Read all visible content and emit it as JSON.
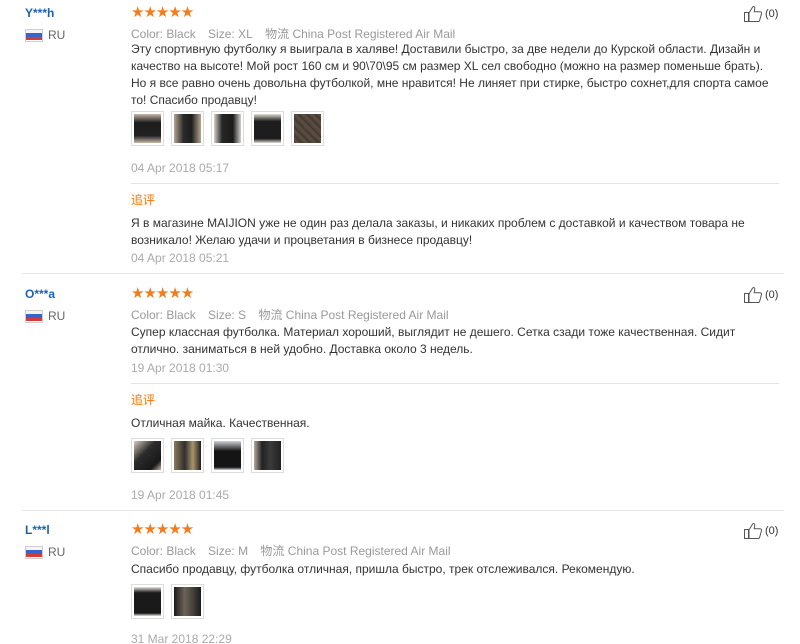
{
  "reviews": [
    {
      "user": "Y***h",
      "country": "RU",
      "stars": "★★★★★",
      "color_label": "Color:",
      "color_value": "Black",
      "size_label": "Size:",
      "size_value": "XL",
      "shipping_label": "物流",
      "shipping_value": "China Post Registered Air Mail",
      "text": "Эту спортивную футболку я выиграла в халяве! Доставили быстро, за две недели до Курской области. Дизайн и качество на высоте! Мой рост 160 см и 90\\70\\95 см размер XL сел свободно (можно на размер поменьше брать). Но я все равно очень довольна футболкой, мне нравится! Не линяет при стирке, быстро сохнет,для спорта самое то! Спасибо продавцу!",
      "photos": [
        "photo-1",
        "photo-2",
        "photo-3",
        "photo-4",
        "photo-5"
      ],
      "date": "04 Apr 2018 05:17",
      "followup_label": "追评",
      "followup_text": "Я в магазине MAIJION уже не один раз делала заказы, и никаких проблем с доставкой и качеством товара не возникало! Желаю удачи и процветания в бизнесе продавцу!",
      "followup_date": "04 Apr 2018 05:21",
      "likes": "(0)"
    },
    {
      "user": "O***a",
      "country": "RU",
      "stars": "★★★★★",
      "color_label": "Color:",
      "color_value": "Black",
      "size_label": "Size:",
      "size_value": "S",
      "shipping_label": "物流",
      "shipping_value": "China Post Registered Air Mail",
      "text": "Супер классная футболка. Материал хороший, выглядит не дешего. Сетка сзади тоже качественная. Сидит отлично. заниматься в ней удобно. Доставка около 3 недель.",
      "date": "19 Apr 2018 01:30",
      "followup_label": "追评",
      "followup_text": "Отличная майка. Качественная.",
      "followup_photos": [
        "photo-1",
        "photo-2",
        "photo-3",
        "photo-4"
      ],
      "followup_date": "19 Apr 2018 01:45",
      "likes": "(0)"
    },
    {
      "user": "L***l",
      "country": "RU",
      "stars": "★★★★★",
      "color_label": "Color:",
      "color_value": "Black",
      "size_label": "Size:",
      "size_value": "M",
      "shipping_label": "物流",
      "shipping_value": "China Post Registered Air Mail",
      "text": "Спасибо продавцу, футболка отличная, пришла быстро, трек отслеживался. Рекомендую.",
      "photos": [
        "photo-1",
        "photo-2"
      ],
      "date": "31 Mar 2018 22:29",
      "likes": "(0)"
    }
  ],
  "colors": {
    "username": "#1a63b4",
    "stars": "#f47c1a",
    "followup": "#ff7300"
  },
  "icons": {
    "like": "thumbs-up-icon",
    "flag": "russia-flag-icon"
  }
}
